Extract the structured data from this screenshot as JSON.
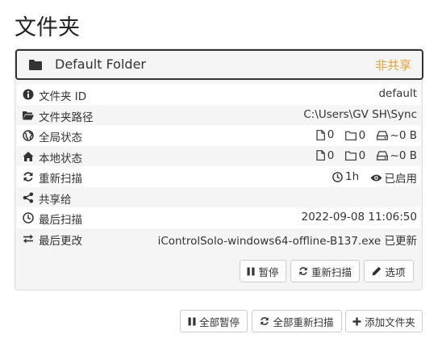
{
  "page": {
    "heading": "文件夹"
  },
  "folder": {
    "name": "Default Folder",
    "share_status": "非共享",
    "share_status_color": "#e0a33b",
    "rows": [
      {
        "icon": "info-icon",
        "label": "文件夹 ID",
        "value": "default"
      },
      {
        "icon": "folder-open-icon",
        "label": "文件夹路径",
        "value": "C:\\Users\\GV SH\\Sync"
      },
      {
        "icon": "globe-icon",
        "label": "全局状态",
        "files": "0",
        "dirs": "0",
        "size": "~0 B"
      },
      {
        "icon": "home-icon",
        "label": "本地状态",
        "files": "0",
        "dirs": "0",
        "size": "~0 B"
      },
      {
        "icon": "refresh-icon",
        "label": "重新扫描",
        "interval": "1h",
        "watch": "已启用"
      },
      {
        "icon": "share-icon",
        "label": "共享给",
        "value": ""
      },
      {
        "icon": "clock-icon",
        "label": "最后扫描",
        "value": "2022-09-08 11:06:50"
      },
      {
        "icon": "exchange-icon",
        "label": "最后更改",
        "value": "iControlSolo-windows64-offline-B137.exe 已更新"
      }
    ],
    "buttons": {
      "pause": "暂停",
      "rescan": "重新扫描",
      "options": "选项"
    }
  },
  "footer": {
    "pause_all": "全部暂停",
    "rescan_all": "全部重新扫描",
    "add_folder": "添加文件夹"
  }
}
